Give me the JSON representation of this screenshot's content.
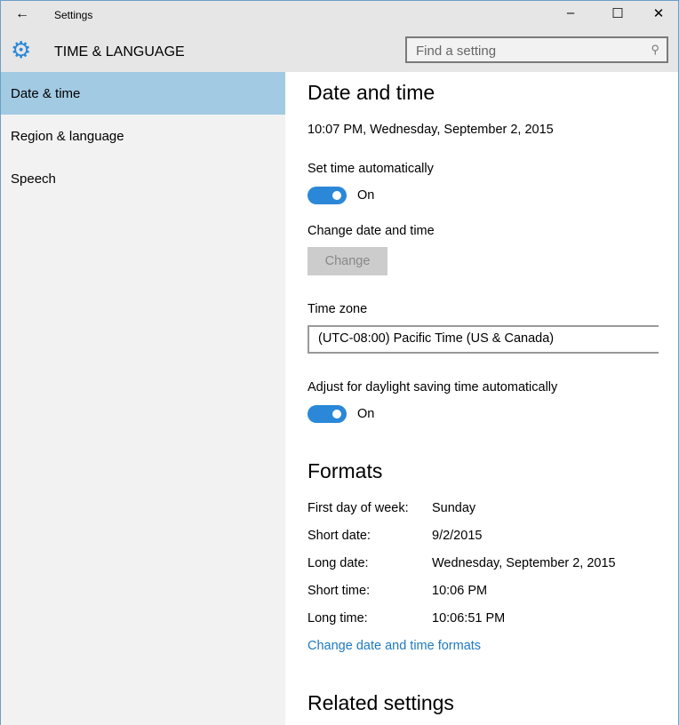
{
  "window": {
    "title": "Settings",
    "minimize": "–",
    "maximize": "☐",
    "close": "✕",
    "back": "←"
  },
  "header": {
    "section": "TIME & LANGUAGE",
    "search_placeholder": "Find a setting",
    "search_icon": "⚲"
  },
  "sidebar": {
    "items": [
      {
        "label": "Date & time",
        "selected": true
      },
      {
        "label": "Region & language"
      },
      {
        "label": "Speech"
      }
    ]
  },
  "main": {
    "title": "Date and time",
    "current": "10:07 PM, Wednesday, September 2, 2015",
    "set_time_label": "Set time automatically",
    "set_time_state": "On",
    "change_label": "Change date and time",
    "change_button": "Change",
    "timezone_label": "Time zone",
    "timezone_value": "(UTC-08:00) Pacific Time (US & Canada)",
    "dst_label": "Adjust for daylight saving time automatically",
    "dst_state": "On",
    "formats_title": "Formats",
    "formats": [
      {
        "label": "First day of week:",
        "value": "Sunday"
      },
      {
        "label": "Short date:",
        "value": "9/2/2015"
      },
      {
        "label": "Long date:",
        "value": "Wednesday, September 2, 2015"
      },
      {
        "label": "Short time:",
        "value": "10:06 PM"
      },
      {
        "label": "Long time:",
        "value": "10:06:51 PM"
      }
    ],
    "formats_link": "Change date and time formats",
    "related_title": "Related settings"
  },
  "colors": {
    "accent": "#2b88d8",
    "selected": "#a2cae3",
    "link": "#1e7ac2"
  }
}
